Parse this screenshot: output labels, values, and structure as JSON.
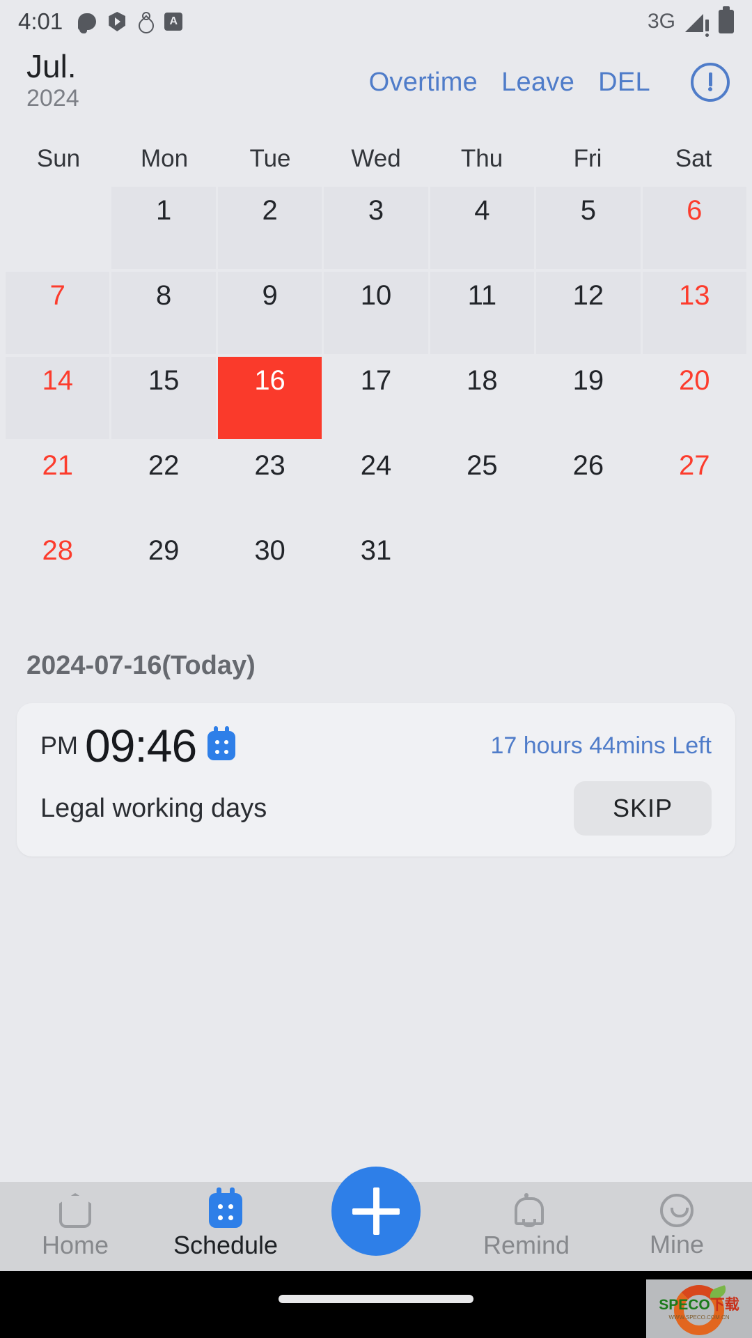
{
  "status_bar": {
    "time": "4:01",
    "left_icons": [
      "chat-icon",
      "play-shield-icon",
      "location-heart-icon",
      "a-box-icon"
    ],
    "network": "3G",
    "right_icons": [
      "signal-warning-icon",
      "battery-icon"
    ]
  },
  "header": {
    "month": "Jul.",
    "year": "2024",
    "actions": [
      {
        "label": "Overtime",
        "name": "overtime"
      },
      {
        "label": "Leave",
        "name": "leave"
      },
      {
        "label": "DEL",
        "name": "del"
      }
    ],
    "info_icon": "exclamation-circle-icon",
    "link_color": "#4f7cc9"
  },
  "calendar": {
    "weekdays": [
      "Sun",
      "Mon",
      "Tue",
      "Wed",
      "Thu",
      "Fri",
      "Sat"
    ],
    "selected_color": "#fa3a2b",
    "weekend_color": "#fc3c2d",
    "cell_shade_color": "#e2e3e8",
    "weeks": [
      [
        {
          "day": "",
          "state": "empty"
        },
        {
          "day": "1",
          "state": "shade"
        },
        {
          "day": "2",
          "state": "shade"
        },
        {
          "day": "3",
          "state": "shade"
        },
        {
          "day": "4",
          "state": "shade"
        },
        {
          "day": "5",
          "state": "shade"
        },
        {
          "day": "6",
          "state": "shade weekend"
        }
      ],
      [
        {
          "day": "7",
          "state": "shade weekend"
        },
        {
          "day": "8",
          "state": "shade"
        },
        {
          "day": "9",
          "state": "shade"
        },
        {
          "day": "10",
          "state": "shade"
        },
        {
          "day": "11",
          "state": "shade"
        },
        {
          "day": "12",
          "state": "shade"
        },
        {
          "day": "13",
          "state": "shade weekend"
        }
      ],
      [
        {
          "day": "14",
          "state": "shade weekend"
        },
        {
          "day": "15",
          "state": "shade"
        },
        {
          "day": "16",
          "state": "selected"
        },
        {
          "day": "17",
          "state": ""
        },
        {
          "day": "18",
          "state": ""
        },
        {
          "day": "19",
          "state": ""
        },
        {
          "day": "20",
          "state": "weekend"
        }
      ],
      [
        {
          "day": "21",
          "state": "weekend"
        },
        {
          "day": "22",
          "state": ""
        },
        {
          "day": "23",
          "state": ""
        },
        {
          "day": "24",
          "state": ""
        },
        {
          "day": "25",
          "state": ""
        },
        {
          "day": "26",
          "state": ""
        },
        {
          "day": "27",
          "state": "weekend"
        }
      ],
      [
        {
          "day": "28",
          "state": "weekend"
        },
        {
          "day": "29",
          "state": ""
        },
        {
          "day": "30",
          "state": ""
        },
        {
          "day": "31",
          "state": ""
        },
        {
          "day": "",
          "state": "empty"
        },
        {
          "day": "",
          "state": "empty"
        },
        {
          "day": "",
          "state": "empty"
        }
      ]
    ]
  },
  "today_label": "2024-07-16(Today)",
  "event_card": {
    "meridiem": "PM",
    "time": "09:46",
    "calendar_icon": "calendar-icon",
    "time_left": "17 hours 44mins Left",
    "subtitle": "Legal working days",
    "skip_label": "SKIP",
    "accent_color": "#2e7fe8"
  },
  "bottom_nav": {
    "items": [
      {
        "label": "Home",
        "icon": "home-icon",
        "active": false
      },
      {
        "label": "Schedule",
        "icon": "calendar-icon",
        "active": true
      },
      {
        "label": "Remind",
        "icon": "bell-icon",
        "active": false
      },
      {
        "label": "Mine",
        "icon": "smiley-icon",
        "active": false
      }
    ],
    "fab_icon": "plus-icon",
    "fab_color": "#2e7fe8"
  },
  "watermark": {
    "title_en": "SPECO",
    "title_cn": "下载",
    "url": "WWW.SPECO.COM.CN"
  }
}
